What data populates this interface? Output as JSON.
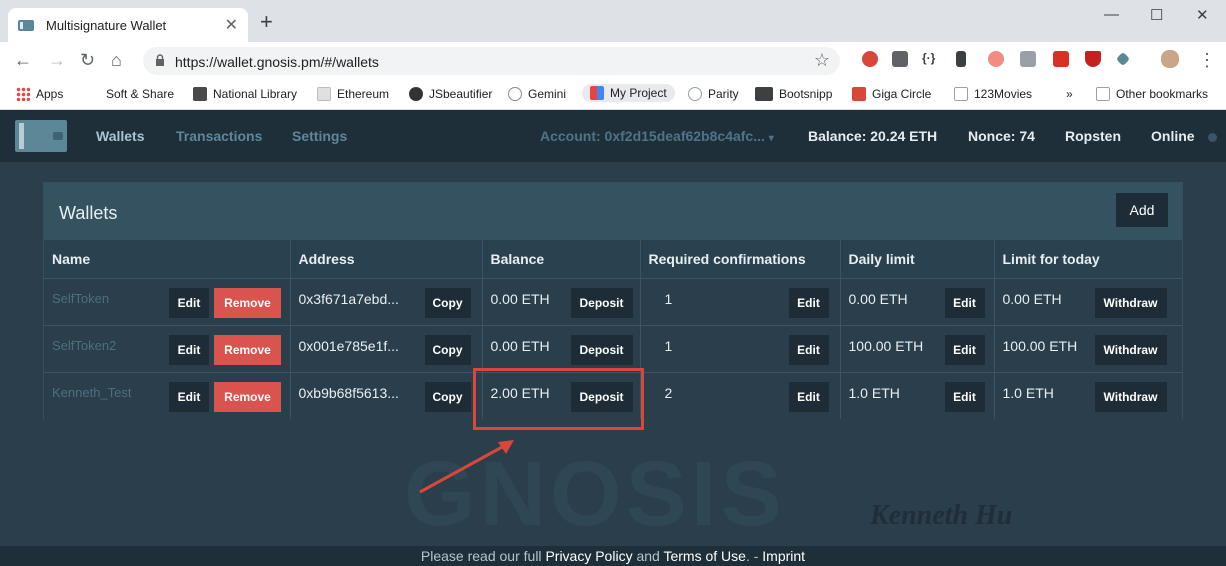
{
  "browser": {
    "tab_title": "Multisignature Wallet",
    "url": "https://wallet.gnosis.pm/#/wallets",
    "bookmarks": [
      {
        "label": "Apps",
        "color": "#e8453c"
      },
      {
        "label": "Soft & Share",
        "color": ""
      },
      {
        "label": "National Library",
        "color": "#4a4a4a"
      },
      {
        "label": "Ethereum",
        "color": "#c0c0c0"
      },
      {
        "label": "JSbeautifier",
        "color": "#333333"
      },
      {
        "label": "Gemini",
        "color": "#8a8a8a"
      },
      {
        "label": "My Project",
        "color": "#e8453c"
      },
      {
        "label": "Parity",
        "color": "#9aa0a6"
      },
      {
        "label": "Bootsnipp",
        "color": "#3c4043"
      },
      {
        "label": "Giga Circle",
        "color": "#d9473a"
      },
      {
        "label": "123Movies",
        "color": "#9aa0a6"
      },
      {
        "label": "»",
        "color": ""
      },
      {
        "label": "Other bookmarks",
        "color": "#f0c040"
      }
    ]
  },
  "nav": {
    "links": [
      "Wallets",
      "Transactions",
      "Settings"
    ],
    "account": "Account: 0xf2d15deaf62b8c4afc...",
    "balance": "Balance: 20.24 ETH",
    "nonce": "Nonce: 74",
    "network": "Ropsten",
    "status": "Online"
  },
  "panel": {
    "title": "Wallets",
    "add_label": "Add",
    "columns": [
      "Name",
      "Address",
      "Balance",
      "Required confirmations",
      "Daily limit",
      "Limit for today"
    ],
    "rows": [
      {
        "name": "SelfToken",
        "address": "0x3f671a7ebd...",
        "balance": "0.00 ETH",
        "confirmations": "1",
        "daily_limit": "0.00 ETH",
        "limit_today": "0.00 ETH"
      },
      {
        "name": "SelfToken2",
        "address": "0x001e785e1f...",
        "balance": "0.00 ETH",
        "confirmations": "1",
        "daily_limit": "100.00 ETH",
        "limit_today": "100.00 ETH"
      },
      {
        "name": "Kenneth_Test",
        "address": "0xb9b68f5613...",
        "balance": "2.00 ETH",
        "confirmations": "2",
        "daily_limit": "1.0 ETH",
        "limit_today": "1.0 ETH"
      }
    ],
    "buttons": {
      "edit": "Edit",
      "remove": "Remove",
      "copy": "Copy",
      "deposit": "Deposit",
      "withdraw": "Withdraw"
    }
  },
  "watermark": "GNOSIS",
  "signature": "Kenneth Hu",
  "footer": {
    "prefix": "Please read our full ",
    "privacy": "Privacy Policy",
    "and": " and ",
    "terms": "Terms of Use",
    "sep": ". - ",
    "imprint": "Imprint"
  },
  "colors": {
    "annotation": "#d9473a",
    "remove": "#d9534f",
    "navbar": "#1e2f3a",
    "background": "#2a3e4b"
  }
}
